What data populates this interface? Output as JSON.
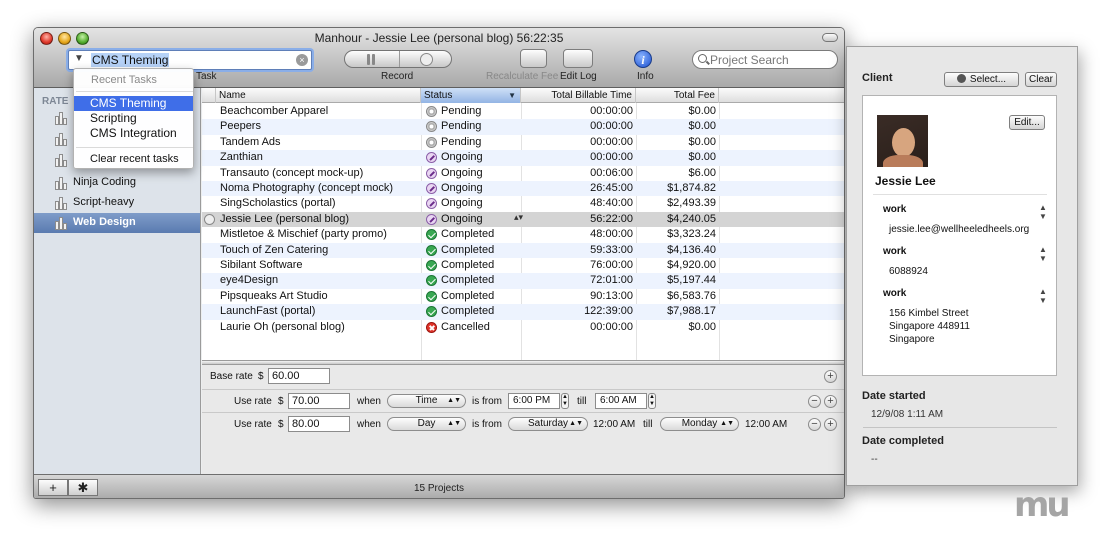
{
  "window": {
    "title": "Manhour - Jessie Lee (personal blog) 56:22:35"
  },
  "toolbar": {
    "task_value": "CMS Theming",
    "task_label": "Task",
    "record_label": "Record",
    "recalc_label": "Recalculate Fee",
    "editlog_label": "Edit Log",
    "info_label": "Info",
    "info_glyph": "i",
    "search_placeholder": "Project Search"
  },
  "dropdown": {
    "header": "Recent Tasks",
    "items": [
      "CMS Theming",
      "Scripting",
      "CMS Integration"
    ],
    "clear_label": "Clear recent tasks"
  },
  "sidebar": {
    "header": "RATE",
    "items": [
      {
        "label": ""
      },
      {
        "label": ""
      },
      {
        "label": ""
      },
      {
        "label": "Ninja Coding"
      },
      {
        "label": "Script-heavy"
      },
      {
        "label": "Web Design"
      }
    ]
  },
  "table": {
    "columns": [
      "Name",
      "Status",
      "Total Billable Time",
      "Total Fee"
    ],
    "sorted_column": "Status",
    "rows": [
      {
        "name": "Beachcomber Apparel",
        "status": "Pending",
        "time": "00:00:00",
        "fee": "$0.00"
      },
      {
        "name": "Peepers",
        "status": "Pending",
        "time": "00:00:00",
        "fee": "$0.00"
      },
      {
        "name": "Tandem Ads",
        "status": "Pending",
        "time": "00:00:00",
        "fee": "$0.00"
      },
      {
        "name": "Zanthian",
        "status": "Ongoing",
        "time": "00:00:00",
        "fee": "$0.00"
      },
      {
        "name": "Transauto (concept mock-up)",
        "status": "Ongoing",
        "time": "00:06:00",
        "fee": "$6.00"
      },
      {
        "name": "Noma Photography (concept mock)",
        "status": "Ongoing",
        "time": "26:45:00",
        "fee": "$1,874.82"
      },
      {
        "name": "SingScholastics (portal)",
        "status": "Ongoing",
        "time": "48:40:00",
        "fee": "$2,493.39"
      },
      {
        "name": "Jessie Lee (personal blog)",
        "status": "Ongoing",
        "time": "56:22:00",
        "fee": "$4,240.05"
      },
      {
        "name": "Mistletoe & Mischief (party promo)",
        "status": "Completed",
        "time": "48:00:00",
        "fee": "$3,323.24"
      },
      {
        "name": "Touch of Zen Catering",
        "status": "Completed",
        "time": "59:33:00",
        "fee": "$4,136.40"
      },
      {
        "name": "Sibilant Software",
        "status": "Completed",
        "time": "76:00:00",
        "fee": "$4,920.00"
      },
      {
        "name": "eye4Design",
        "status": "Completed",
        "time": "72:01:00",
        "fee": "$5,197.44"
      },
      {
        "name": "Pipsqueaks Art Studio",
        "status": "Completed",
        "time": "90:13:00",
        "fee": "$6,583.76"
      },
      {
        "name": "LaunchFast (portal)",
        "status": "Completed",
        "time": "122:39:00",
        "fee": "$7,988.17"
      },
      {
        "name": "Laurie Oh (personal blog)",
        "status": "Cancelled",
        "time": "00:00:00",
        "fee": "$0.00"
      }
    ]
  },
  "rates": {
    "base_label": "Base rate",
    "currency": "$",
    "base_value": "60.00",
    "use_label": "Use rate",
    "when_label": "when",
    "is_from_label": "is from",
    "till_label": "till",
    "rule1": {
      "value": "70.00",
      "type": "Time",
      "from": "6:00 PM",
      "till": "6:00 AM"
    },
    "rule2": {
      "value": "80.00",
      "type": "Day",
      "from_day": "Saturday",
      "from_time": "12:00 AM",
      "till_day": "Monday",
      "till_time": "12:00 AM"
    }
  },
  "bottom": {
    "add_glyph": "+",
    "gear_glyph": "✱",
    "status": "15 Projects"
  },
  "inspector": {
    "client_label": "Client",
    "select_label": "Select...",
    "clear_label": "Clear",
    "edit_label": "Edit...",
    "contact_name": "Jessie Lee",
    "fields": [
      {
        "type": "work",
        "value_lines": [
          "jessie.lee@wellheeledheels.org"
        ]
      },
      {
        "type": "work",
        "value_lines": [
          "6088924"
        ]
      },
      {
        "type": "work",
        "value_lines": [
          "156 Kimbel Street",
          "Singapore 448911",
          "Singapore"
        ]
      }
    ],
    "date_started_label": "Date started",
    "date_started_value": "12/9/08 1:11 AM",
    "date_completed_label": "Date completed",
    "date_completed_value": "--"
  },
  "watermark": "mu",
  "colors": {
    "selection_blue": "#3f6ee8",
    "sidebar_selected": "#5a7bb0",
    "completed_green": "#39a852",
    "cancelled_red": "#e0342a",
    "ongoing_purple": "#8b5ea8"
  }
}
